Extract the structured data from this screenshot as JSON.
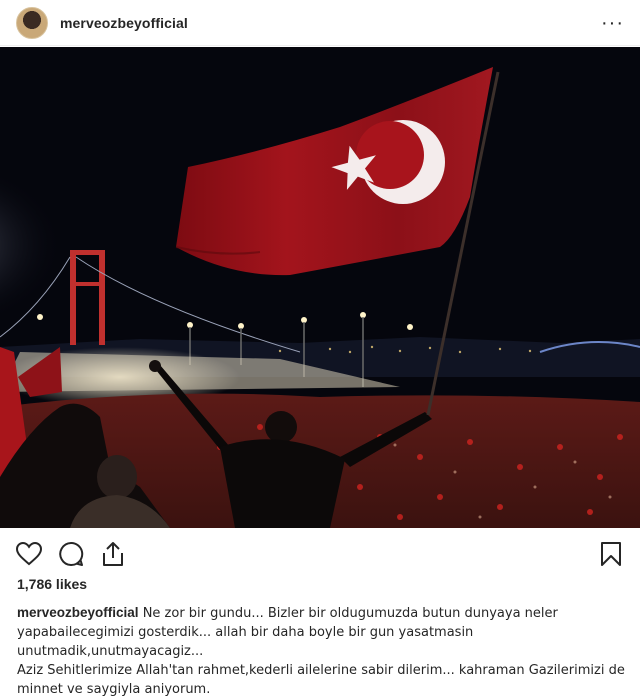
{
  "post": {
    "username": "merveozbeyofficial",
    "more_label": "···",
    "likes": "1,786 likes",
    "caption": {
      "username": "merveozbeyofficial",
      "line1": "Ne zor bir gundu... Bizler bir oldugumuzda butun dunyaya neler",
      "line2": "yapabailecegimizi gosterdik... allah bir daha boyle bir gun yasatmasin",
      "line3": "unutmadik,unutmayacagiz...",
      "line4": "Aziz Sehitlerimize Allah'tan rahmet,kederli ailelerine sabir dilerim... kahraman Gazilerimizi de",
      "line5": "minnet ve saygiyla aniyorum."
    }
  },
  "icons": {
    "avatar": "profile-photo",
    "more": "more-options-icon",
    "like": "heart-icon",
    "comment": "comment-bubble-icon",
    "share": "share-icon",
    "save": "bookmark-icon"
  },
  "colors": {
    "text": "#262626",
    "flag_red": "#b3121c",
    "sky": "#05060d"
  }
}
